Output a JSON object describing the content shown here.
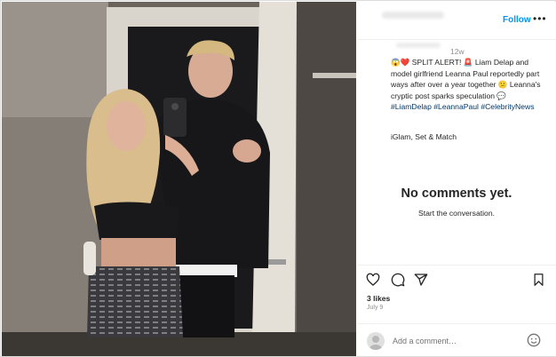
{
  "post": {
    "header": {
      "follow_label": "Follow",
      "more_label": "•••"
    },
    "caption": {
      "time_ago": "12w",
      "text": "😱❤️ SPLIT ALERT! 🚨 Liam Delap and model girlfriend Leanna Paul reportedly part ways after over a year together 😕 Leanna's cryptic post sparks speculation 💬 ",
      "hashtags": [
        "#LiamDelap",
        "#LeannaPaul",
        "#CelebrityNews"
      ],
      "source": "iGlam, Set & Match"
    },
    "comments": {
      "empty_title": "No comments yet.",
      "empty_subtitle": "Start the conversation."
    },
    "actions": {
      "like_icon": "heart-icon",
      "comment_icon": "comment-icon",
      "share_icon": "share-icon",
      "save_icon": "bookmark-icon"
    },
    "likes": "3 likes",
    "date": "July 9",
    "add_comment": {
      "placeholder": "Add a comment…",
      "emoji_icon": "emoji-icon"
    }
  },
  "colors": {
    "link_blue": "#0095f6",
    "hashtag_blue": "#00376b",
    "muted": "#8e8e8e",
    "border": "#dbdbdb"
  }
}
